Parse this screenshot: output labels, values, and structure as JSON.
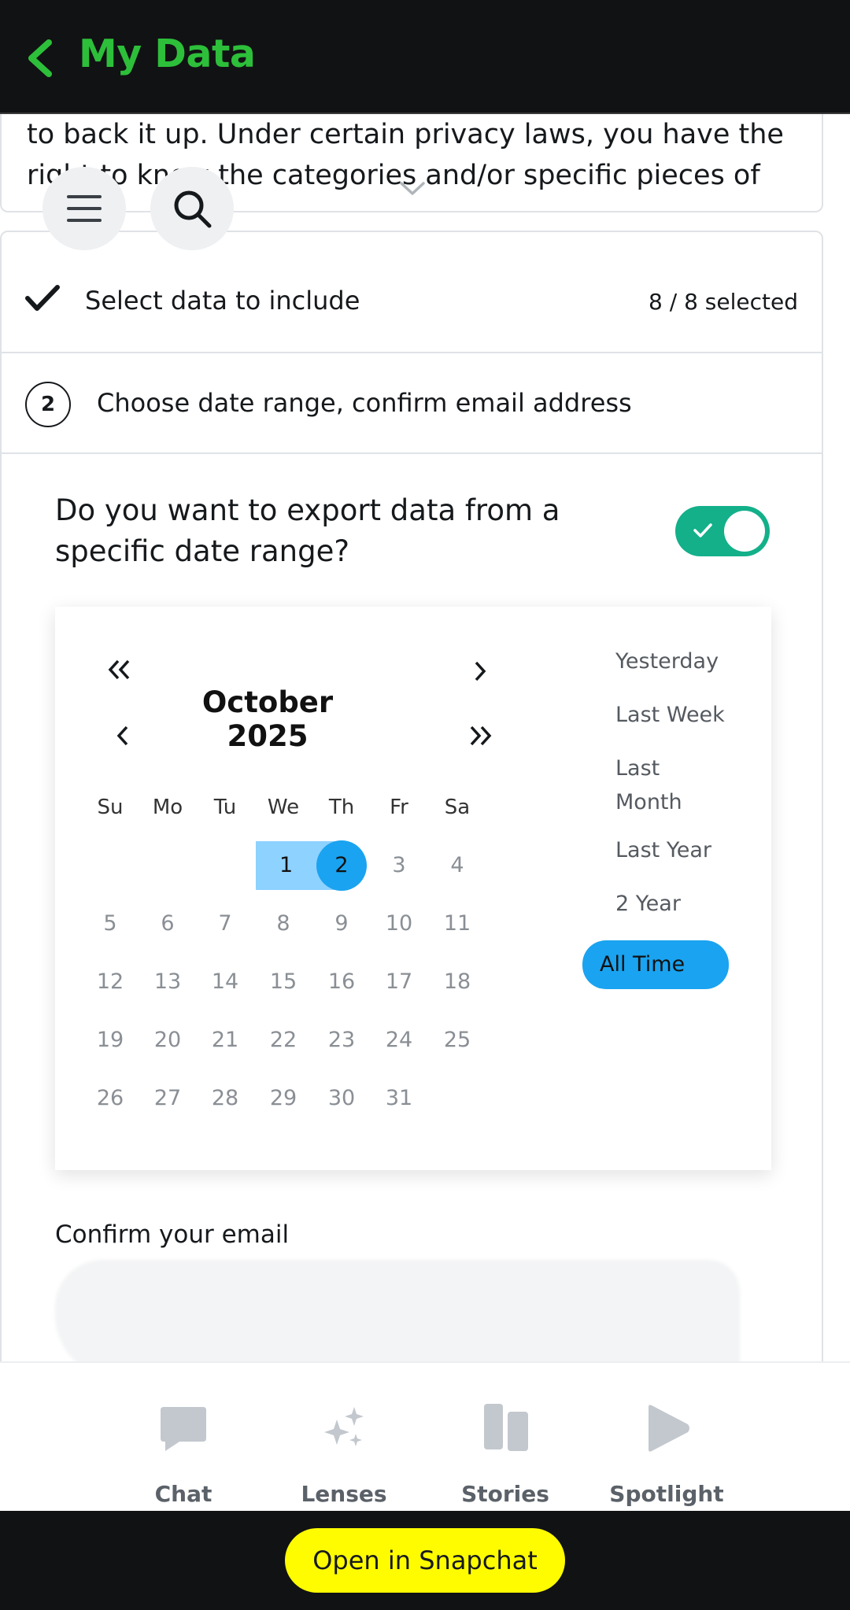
{
  "header": {
    "title": "My Data"
  },
  "intro": {
    "text": "to back it up. Under certain privacy laws, you have the right to know the categories and/or specific pieces of"
  },
  "steps": {
    "step1": {
      "label": "Select data to include",
      "count": "8 / 8 selected"
    },
    "step2": {
      "number": "2",
      "label": "Choose date range, confirm email address"
    }
  },
  "date_range": {
    "question": "Do you want to export data from a specific date range?",
    "toggle_on": true,
    "accent": "#13b08a"
  },
  "calendar": {
    "month_label": "October 2025",
    "weekdays": [
      "Su",
      "Mo",
      "Tu",
      "We",
      "Th",
      "Fr",
      "Sa"
    ],
    "rows": [
      [
        "",
        "",
        "",
        "1",
        "2",
        "3",
        "4"
      ],
      [
        "5",
        "6",
        "7",
        "8",
        "9",
        "10",
        "11"
      ],
      [
        "12",
        "13",
        "14",
        "15",
        "16",
        "17",
        "18"
      ],
      [
        "19",
        "20",
        "21",
        "22",
        "23",
        "24",
        "25"
      ],
      [
        "26",
        "27",
        "28",
        "29",
        "30",
        "31",
        ""
      ]
    ],
    "range_start": "1",
    "selected": "2",
    "selected_color": "#1aa3f0",
    "range_color": "#8ed2ff"
  },
  "presets": [
    "Yesterday",
    "Last Week",
    "Last Month",
    "Last Year",
    "2 Year",
    "All Time"
  ],
  "presets_active": "All Time",
  "email": {
    "label": "Confirm your email"
  },
  "tabs": [
    {
      "label": "Chat",
      "icon": "chat-icon"
    },
    {
      "label": "Lenses",
      "icon": "sparkles-icon"
    },
    {
      "label": "Stories",
      "icon": "stories-icon"
    },
    {
      "label": "Spotlight",
      "icon": "play-icon"
    }
  ],
  "cta": {
    "label": "Open in Snapchat",
    "color": "#fffc00"
  }
}
